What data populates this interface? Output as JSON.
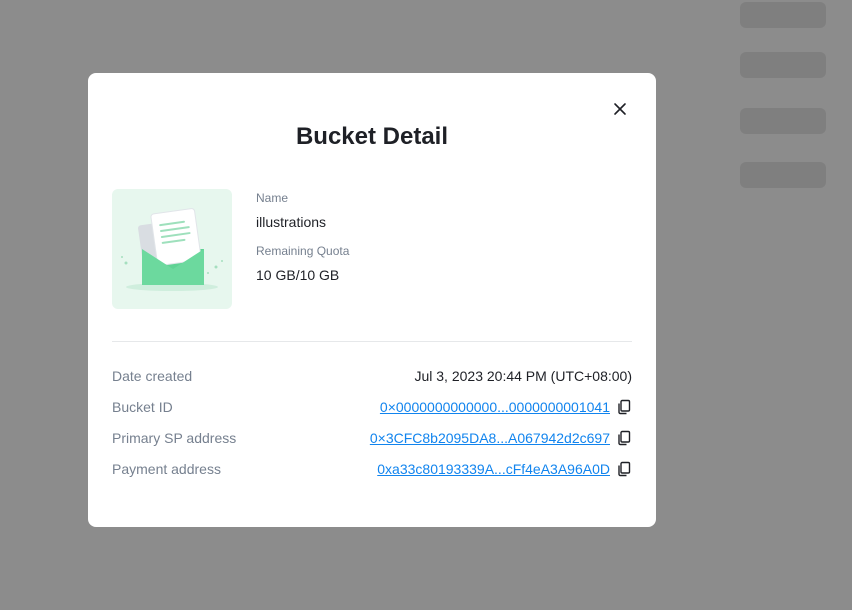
{
  "modal": {
    "title": "Bucket Detail",
    "name_label": "Name",
    "name_value": "illustrations",
    "quota_label": "Remaining Quota",
    "quota_value": "10 GB/10 GB"
  },
  "details": [
    {
      "label": "Date created",
      "value": "Jul 3, 2023 20:44 PM (UTC+08:00)",
      "link": false
    },
    {
      "label": "Bucket ID",
      "value": "0×0000000000000...0000000001041",
      "link": true
    },
    {
      "label": "Primary SP address",
      "value": "0×3CFC8b2095DA8...A067942d2c697",
      "link": true
    },
    {
      "label": "Payment address",
      "value": "0xa33c80193339A...cFf4eA3A96A0D",
      "link": true
    }
  ],
  "icons": {
    "close": "close-icon",
    "copy": "copy-icon",
    "thumbnail": "envelope-document-illustration"
  },
  "colors": {
    "link": "#1184ee",
    "thumbnail_bg": "#e7f7ee",
    "envelope": "#5fd394"
  }
}
